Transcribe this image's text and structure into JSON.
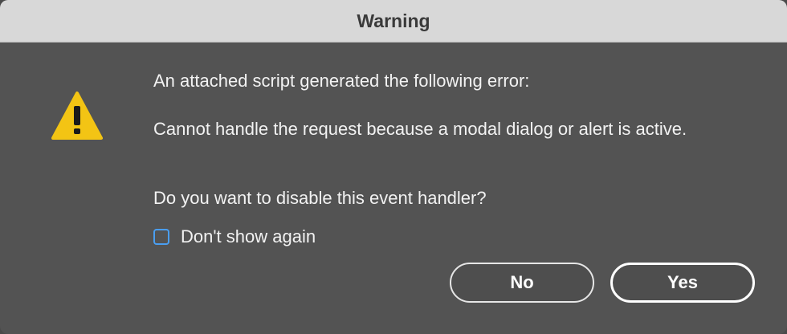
{
  "dialog": {
    "title": "Warning",
    "icon": "warning-icon",
    "message_line1": "An attached script generated the following error:",
    "message_error": "Cannot handle the request because a modal dialog or alert is active.",
    "message_question": "Do you want to disable this event handler?",
    "checkbox_label": "Don't show again",
    "checkbox_checked": false,
    "buttons": {
      "no_label": "No",
      "yes_label": "Yes"
    }
  },
  "colors": {
    "background": "#535353",
    "titlebar": "#d8d8d8",
    "warning_yellow": "#f3c414",
    "checkbox_blue": "#4a9ef0"
  }
}
